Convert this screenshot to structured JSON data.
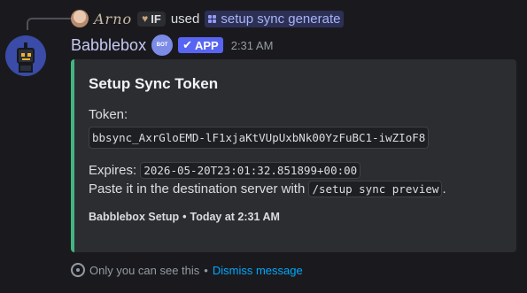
{
  "reply": {
    "user_name": "Arno",
    "tag_heart_icon": "heart-icon",
    "tag_label": "IF",
    "used_text": "used",
    "command": "setup sync generate"
  },
  "message": {
    "author": "Babblebox",
    "bot_badge": "BOT",
    "app_tag": "APP",
    "timestamp": "2:31 AM"
  },
  "embed": {
    "accent_color": "#43b581",
    "title": "Setup Sync Token",
    "token_label": "Token:",
    "token_value": "bbsync_AxrGloEMD-lF1xjaKtVUpUxbNk00YzFuBC1-iwZIoF8",
    "expires_label": "Expires:",
    "expires_value": "2026-05-20T23:01:32.851899+00:00",
    "paste_text": "Paste it in the destination server with",
    "preview_command": "/setup sync preview",
    "paste_end": ".",
    "footer_source": "Babblebox Setup",
    "footer_separator": "•",
    "footer_time": "Today at 2:31 AM"
  },
  "ephemeral": {
    "notice": "Only you can see this",
    "separator": "•",
    "dismiss": "Dismiss message"
  }
}
